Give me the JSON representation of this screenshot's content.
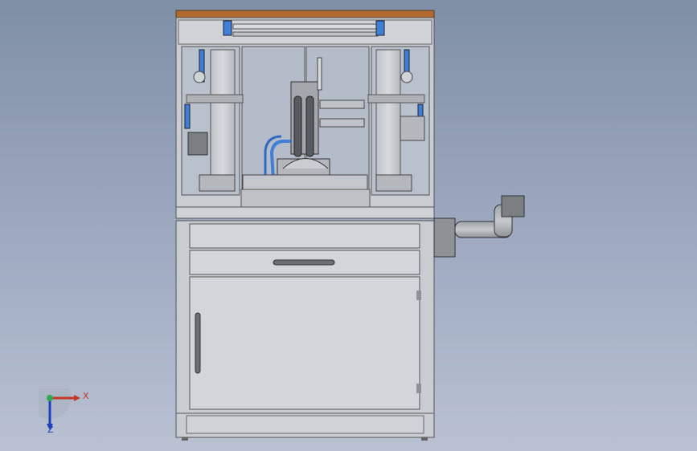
{
  "viewport": {
    "background_top": "#7f8fa6",
    "background_bottom": "#b9c1d2"
  },
  "model": {
    "frame_color": "#c9ccd1",
    "panel_color": "#cfd2d6",
    "glass_color": "#b8c1cc",
    "wood_top_color": "#b06a30",
    "accent_blue": "#3f7fd6",
    "motor_color": "#7b7f7f"
  },
  "triad": {
    "x_label": "X",
    "z_label": "Z",
    "x_color": "#c0392b",
    "y_color": "#2fa84f",
    "z_color": "#1f3fbf",
    "icon": "coordinate-triad-icon"
  }
}
